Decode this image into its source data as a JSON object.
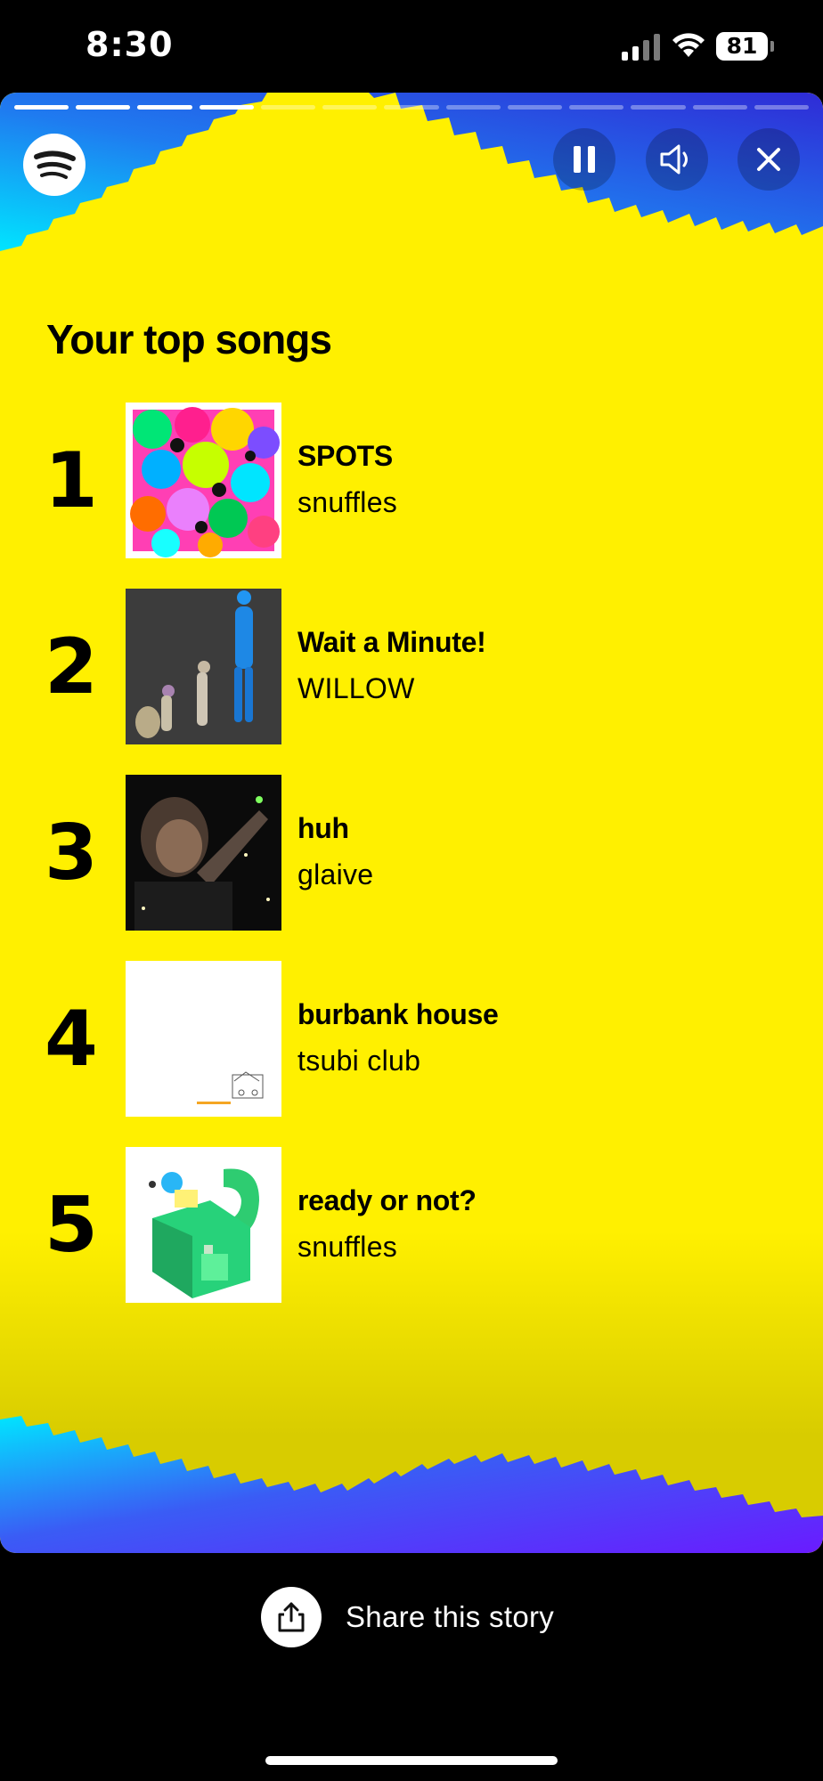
{
  "status_bar": {
    "time": "8:30",
    "battery": "81"
  },
  "story": {
    "title": "Your top songs",
    "progress": {
      "total_segments": 13,
      "completed_segments": 4
    },
    "controls": {
      "pause_icon": "pause-icon",
      "sound_icon": "speaker-icon",
      "close_icon": "close-icon"
    },
    "colors": {
      "background": "#fff000",
      "wave_top": [
        "#2f2bd6",
        "#00e5ff"
      ],
      "wave_bottom": [
        "#00e5ff",
        "#6a1bff"
      ]
    },
    "songs": [
      {
        "rank": "1",
        "title": "SPOTS",
        "artist": "snuffles",
        "art": "colorful-flowers-art"
      },
      {
        "rank": "2",
        "title": "Wait a Minute!",
        "artist": "WILLOW",
        "art": "figures-grey-art"
      },
      {
        "rank": "3",
        "title": "huh",
        "artist": "glaive",
        "art": "dark-photo-art"
      },
      {
        "rank": "4",
        "title": "burbank house",
        "artist": "tsubi club",
        "art": "white-sketch-art"
      },
      {
        "rank": "5",
        "title": "ready or not?",
        "artist": "snuffles",
        "art": "green-buildings-art"
      }
    ]
  },
  "share": {
    "label": "Share this story",
    "icon": "share-icon"
  }
}
